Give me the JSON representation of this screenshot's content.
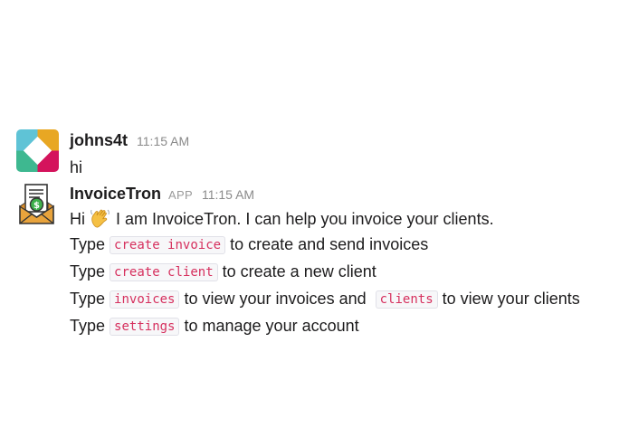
{
  "messages": [
    {
      "author": "johns4t",
      "time": "11:15 AM",
      "avatar_icon": "slack-logo-avatar",
      "text": "hi"
    },
    {
      "author": "InvoiceTron",
      "badge": "APP",
      "time": "11:15 AM",
      "avatar_icon": "invoice-envelope-avatar",
      "lines": {
        "greeting_hi": "Hi",
        "greeting_emoji": "waving-hand-icon",
        "greeting_rest": "I am InvoiceTron. I can help you invoice your clients.",
        "l1_type": "Type",
        "l1_code": "create invoice",
        "l1_rest": "to create and send invoices",
        "l2_type": "Type",
        "l2_code": "create client",
        "l2_rest": "to create a new client",
        "l3_type": "Type",
        "l3_code": "invoices",
        "l3_mid": "to view your invoices and",
        "l3_code2": "clients",
        "l3_rest": "to view your clients",
        "l4_type": "Type",
        "l4_code": "settings",
        "l4_rest": "to manage your account"
      }
    }
  ],
  "colors": {
    "code_text": "#d6305e",
    "code_bg": "#f7f7f9",
    "timestamp": "#8a8a8a"
  }
}
